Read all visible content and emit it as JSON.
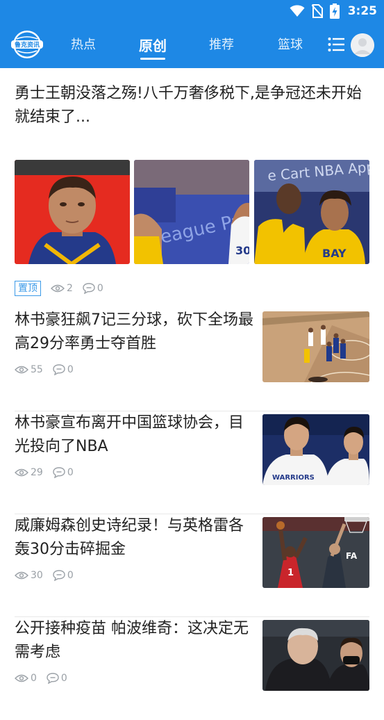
{
  "status_bar": {
    "time": "3:25",
    "icons": [
      "wifi-icon",
      "no-sim-icon",
      "battery-charging-icon"
    ]
  },
  "app": {
    "logo_text": "鲁克资讯",
    "tabs": [
      {
        "label": "热点",
        "active": false
      },
      {
        "label": "原创",
        "active": true
      },
      {
        "label": "推荐",
        "active": false
      },
      {
        "label": "篮球",
        "active": false
      }
    ],
    "menu_icon": "list-menu-icon",
    "avatar_icon": "user-avatar-icon"
  },
  "featured": {
    "title": "勇士王朝没落之殇!八千万奢侈税下,是争冠还未开始就结束了...",
    "badge": "置顶",
    "views": "2",
    "comments": "0",
    "images": [
      "curry-portrait",
      "curry-league-pass",
      "oubre-bay-jersey"
    ]
  },
  "news": [
    {
      "title": "林书豪狂飙7记三分球，砍下全场最高29分率勇士夺首胜",
      "views": "55",
      "comments": "0",
      "image": "basketball-court-game"
    },
    {
      "title": "林书豪宣布离开中国篮球协会，目光投向了NBA",
      "views": "29",
      "comments": "0",
      "image": "warriors-players"
    },
    {
      "title": "威廉姆森创史诗纪录！与英格雷各轰30分击碎掘金",
      "views": "30",
      "comments": "0",
      "image": "pelicans-dunk"
    },
    {
      "title": "公开接种疫苗 帕波维奇：这决定无需考虑",
      "views": "0",
      "comments": "0",
      "image": "popovich-coach"
    }
  ],
  "colors": {
    "header_bg": "#1e88e5",
    "badge": "#3b9ae8",
    "meta_text": "#9aa0a6",
    "title_text": "#222222"
  }
}
